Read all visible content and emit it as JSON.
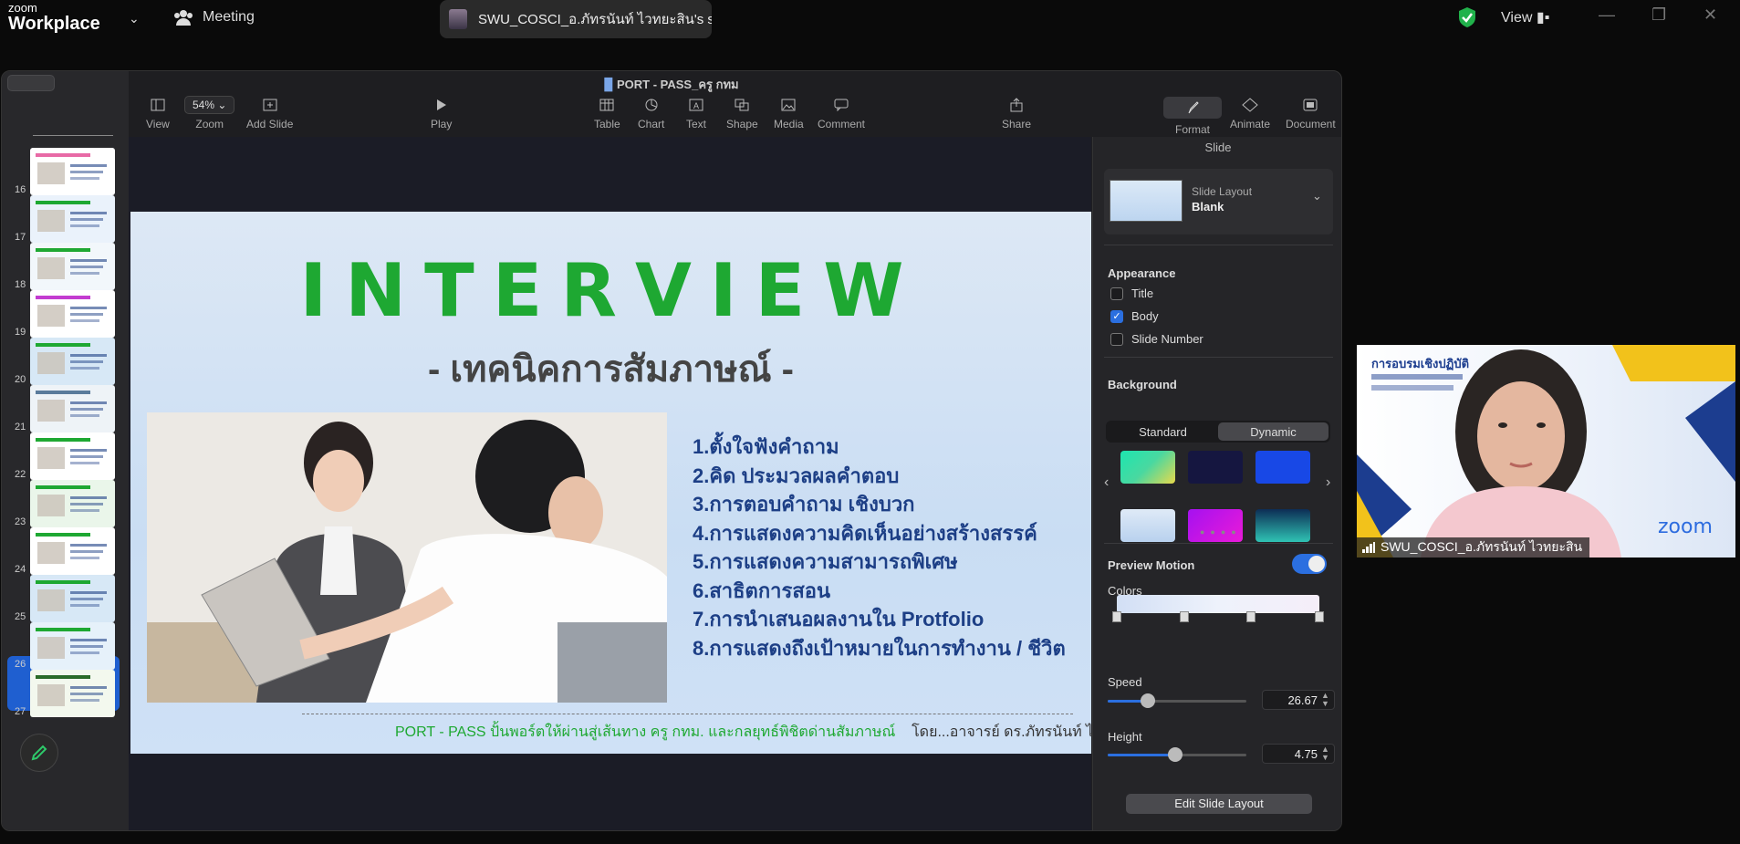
{
  "zoom": {
    "logo_small": "zoom",
    "logo_big": "Workplace",
    "meeting_label": "Meeting",
    "share_title": "SWU_COSCI_อ.ภัทรนันท์ ไวทยะสิน's s",
    "view_label": "View"
  },
  "keynote": {
    "title": "PORT - PASS_ครู กทม",
    "toolbar": {
      "view": "View",
      "zoom_value": "54%",
      "zoom": "Zoom",
      "add_slide": "Add Slide",
      "play": "Play",
      "table": "Table",
      "chart": "Chart",
      "text": "Text",
      "shape": "Shape",
      "media": "Media",
      "comment": "Comment",
      "share": "Share",
      "format": "Format",
      "animate": "Animate",
      "document": "Document"
    },
    "thumb_numbers": [
      "16",
      "17",
      "18",
      "19",
      "20",
      "21",
      "22",
      "23",
      "24",
      "25",
      "26",
      "27"
    ],
    "selected_slide": "25"
  },
  "slide": {
    "title": "INTERVIEW",
    "subtitle": "- เทคนิคการสัมภาษณ์ -",
    "items": [
      "1.ตั้งใจฟังคำถาม",
      "2.คิด ประมวลผลคำตอบ",
      "3.การตอบคำถาม เชิงบวก",
      "4.การแสดงความคิดเห็นอย่างสร้างสรรค์",
      "5.การแสดงความสามารถพิเศษ",
      "6.สาธิตการสอน",
      "7.การนำเสนอผลงานใน Protfolio",
      "8.การแสดงถึงเป้าหมายในการทำงาน / ชีวิต"
    ],
    "footer_green": "PORT - PASS ปั้นพอร์ตให้ผ่านสู่เส้นทาง ครู กทม. และกลยุทธ์พิชิตด่านสัมภาษณ์",
    "footer_author": "โดย...อาจารย์ ดร.ภัทรนันท์ ไวทยะสิน"
  },
  "inspector": {
    "header": "Slide",
    "layout_label": "Slide Layout",
    "layout_value": "Blank",
    "appearance": "Appearance",
    "cb_title": "Title",
    "cb_body": "Body",
    "cb_slide_number": "Slide Number",
    "background": "Background",
    "seg_standard": "Standard",
    "seg_dynamic": "Dynamic",
    "preview_motion": "Preview Motion",
    "colors": "Colors",
    "speed": "Speed",
    "speed_value": "26.67",
    "height": "Height",
    "height_value": "4.75",
    "edit_layout": "Edit Slide Layout",
    "swatches": [
      "#19d99a",
      "#151640",
      "#1848e6",
      "#dce8f6",
      "#c614e8",
      "#1ea8a8"
    ]
  },
  "video": {
    "name": "SWU_COSCI_อ.ภัทรนันท์ ไวทยะสิน",
    "bg_heading": "การอบรมเชิงปฏิบัติ",
    "brand": "zoom"
  }
}
